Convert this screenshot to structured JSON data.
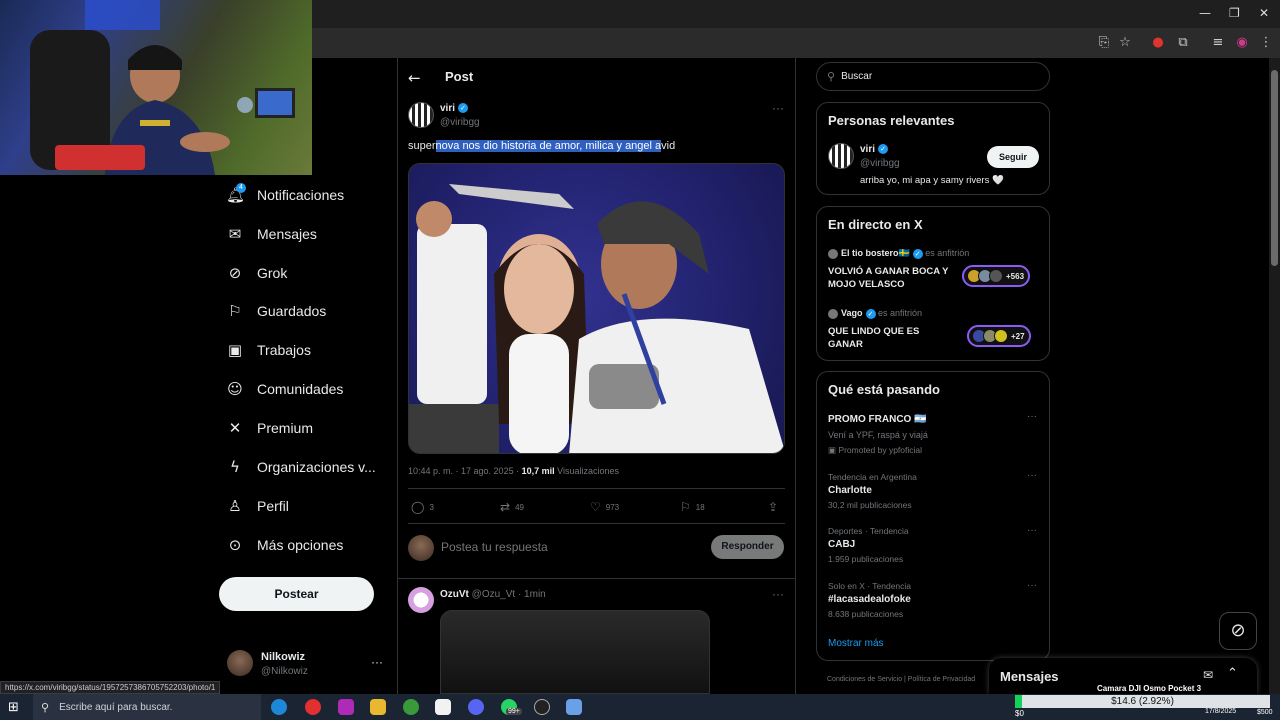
{
  "status_url": "https://x.com/viribgg/status/1957257386705752203/photo/1",
  "nav": {
    "notif_count": "4",
    "items": [
      "Notificaciones",
      "Mensajes",
      "Grok",
      "Guardados",
      "Trabajos",
      "Comunidades",
      "Premium",
      "Organizaciones v...",
      "Perfil",
      "Más opciones"
    ],
    "post_button": "Postear",
    "user_name": "Nilkowiz",
    "user_handle": "@Nilkowiz"
  },
  "header": {
    "title": "Post"
  },
  "post": {
    "name": "viri",
    "handle": "@viribgg",
    "text_before": "super",
    "text_highlight": "nova nos dio historia de amor, milica y angel a",
    "text_after": "vid",
    "time": "10:44 p. m. · 17 ago. 2025 · ",
    "views": "10,7 mil",
    "views_label": " Visualizaciones",
    "replies": "3",
    "reposts": "49",
    "likes": "973",
    "bookmarks": "18",
    "reply_placeholder": "Postea tu respuesta",
    "reply_button": "Responder"
  },
  "reply": {
    "name": "OzuVt",
    "handle_time": "@Ozu_Vt · 1min"
  },
  "search": {
    "placeholder": "Buscar"
  },
  "relevant": {
    "title": "Personas relevantes",
    "name": "viri",
    "handle": "@viribgg",
    "bio": "arriba yo, mi apa y samy rivers 🤍",
    "follow": "Seguir"
  },
  "live": {
    "title": "En directo en X",
    "items": [
      {
        "host": "El tio bostero🇸🇪",
        "role": "es anfitrión",
        "title": "VOLVIÓ A GANAR BOCA Y MOJO VELASCO",
        "count": "+563"
      },
      {
        "host": "Vago",
        "role": "es anfitrión",
        "title": "QUE LINDO QUE ES GANAR",
        "count": "+27"
      }
    ]
  },
  "trends": {
    "title": "Qué está pasando",
    "promo": {
      "title": "PROMO FRANCO 🇦🇷",
      "desc": "Vení a YPF, raspá y viajá",
      "promoted": "Promoted by ypfoficial"
    },
    "items": [
      {
        "meta": "Tendencia en Argentina",
        "title": "Charlotte",
        "count": "30,2 mil publicaciones"
      },
      {
        "meta": "Deportes · Tendencia",
        "title": "CABJ",
        "count": "1.959 publicaciones"
      },
      {
        "meta": "Solo en X · Tendencia",
        "title": "#lacasadealofoke",
        "count": "8.638 publicaciones"
      }
    ],
    "show_more": "Mostrar más"
  },
  "footer": "Condiciones de Servicio  |  Política de Privacidad",
  "messages": {
    "title": "Mensajes"
  },
  "overlay": {
    "cam_label": "Camara DJI Osmo Pocket 3",
    "donation": "$14.6 (2.92%)",
    "progress_fraction": 0.0292,
    "min": "$0",
    "max": "$500"
  },
  "taskbar": {
    "search_placeholder": "Escribe aquí para buscar.",
    "badge": "99+",
    "date": "17/8/2025"
  },
  "colors": {
    "accent": "#1d9bf0",
    "live_ring": "#8a5cf5",
    "progress": "#14d35a"
  }
}
